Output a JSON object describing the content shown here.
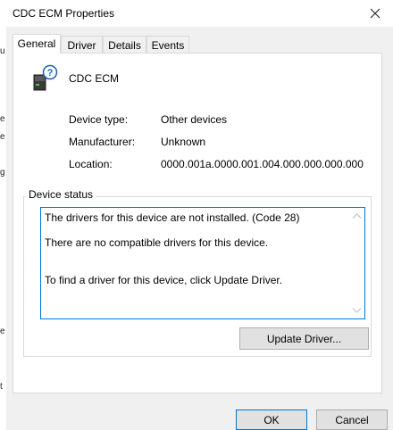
{
  "window": {
    "title": "CDC ECM Properties"
  },
  "tabs": [
    {
      "label": "General",
      "active": true
    },
    {
      "label": "Driver",
      "active": false
    },
    {
      "label": "Details",
      "active": false
    },
    {
      "label": "Events",
      "active": false
    }
  ],
  "device": {
    "name": "CDC ECM",
    "icon": "unknown-device-icon"
  },
  "properties": [
    {
      "label": "Device type:",
      "value": "Other devices"
    },
    {
      "label": "Manufacturer:",
      "value": "Unknown"
    },
    {
      "label": "Location:",
      "value": "0000.001a.0000.001.004.000.000.000.000"
    }
  ],
  "status": {
    "legend": "Device status",
    "lines": [
      "The drivers for this device are not installed. (Code 28)",
      "There are no compatible drivers for this device.",
      "To find a driver for this device, click Update Driver."
    ]
  },
  "buttons": {
    "update_driver": "Update Driver...",
    "ok": "OK",
    "cancel": "Cancel"
  },
  "background_window": {
    "edge_chars": [
      "u",
      "e",
      "e",
      "g",
      "e",
      "t"
    ]
  },
  "colors": {
    "accent": "#0078d7",
    "dialog_bg": "#f0f0f0",
    "border": "#d9d9d9"
  }
}
